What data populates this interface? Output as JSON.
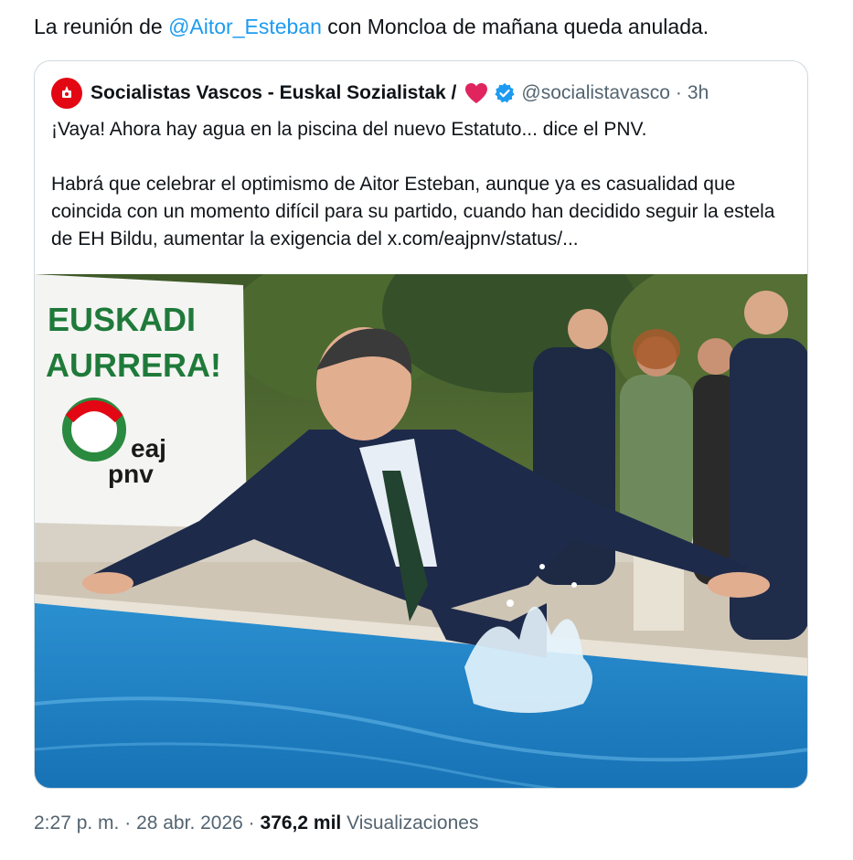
{
  "tweet": {
    "text_before": "La reunión de ",
    "mention": "@Aitor_Esteban",
    "text_after": " con Moncloa de mañana queda anulada."
  },
  "quote": {
    "author_name": "Socialistas Vascos - Euskal Sozialistak /",
    "handle": "@socialistavasco",
    "separator": "·",
    "time": "3h",
    "line1": "¡Vaya! Ahora hay agua en la piscina del nuevo Estatuto... dice el PNV.",
    "para2_text": "Habrá que celebrar el optimismo de Aitor Esteban, aunque ya es casualidad que coincida con un momento difícil para su partido, cuando han decidido seguir la estela de EH Bildu, aumentar la exigencia del ",
    "link": "x.com/eajpnv/status/...",
    "avatar_text": "PSE-EE PSOE",
    "icons": {
      "heart": "heart-icon",
      "verified": "verified-badge-icon"
    }
  },
  "photo": {
    "banner_line1": "EUSKADI",
    "banner_line2": "AURRERA!",
    "banner_logo_line1": "eaj",
    "banner_logo_line2": "pnv"
  },
  "footer": {
    "time": "2:27 p. m.",
    "sep1": " · ",
    "date": "28 abr. 2026",
    "sep2": " · ",
    "views_count": "376,2 mil",
    "views_label": " Visualizaciones"
  },
  "colors": {
    "mention": "#1d9bf0",
    "secondary_text": "#536471",
    "border": "#cfd9de",
    "heart": "#e0245e",
    "verified": "#1d9bf0",
    "avatar_red": "#e30613"
  }
}
